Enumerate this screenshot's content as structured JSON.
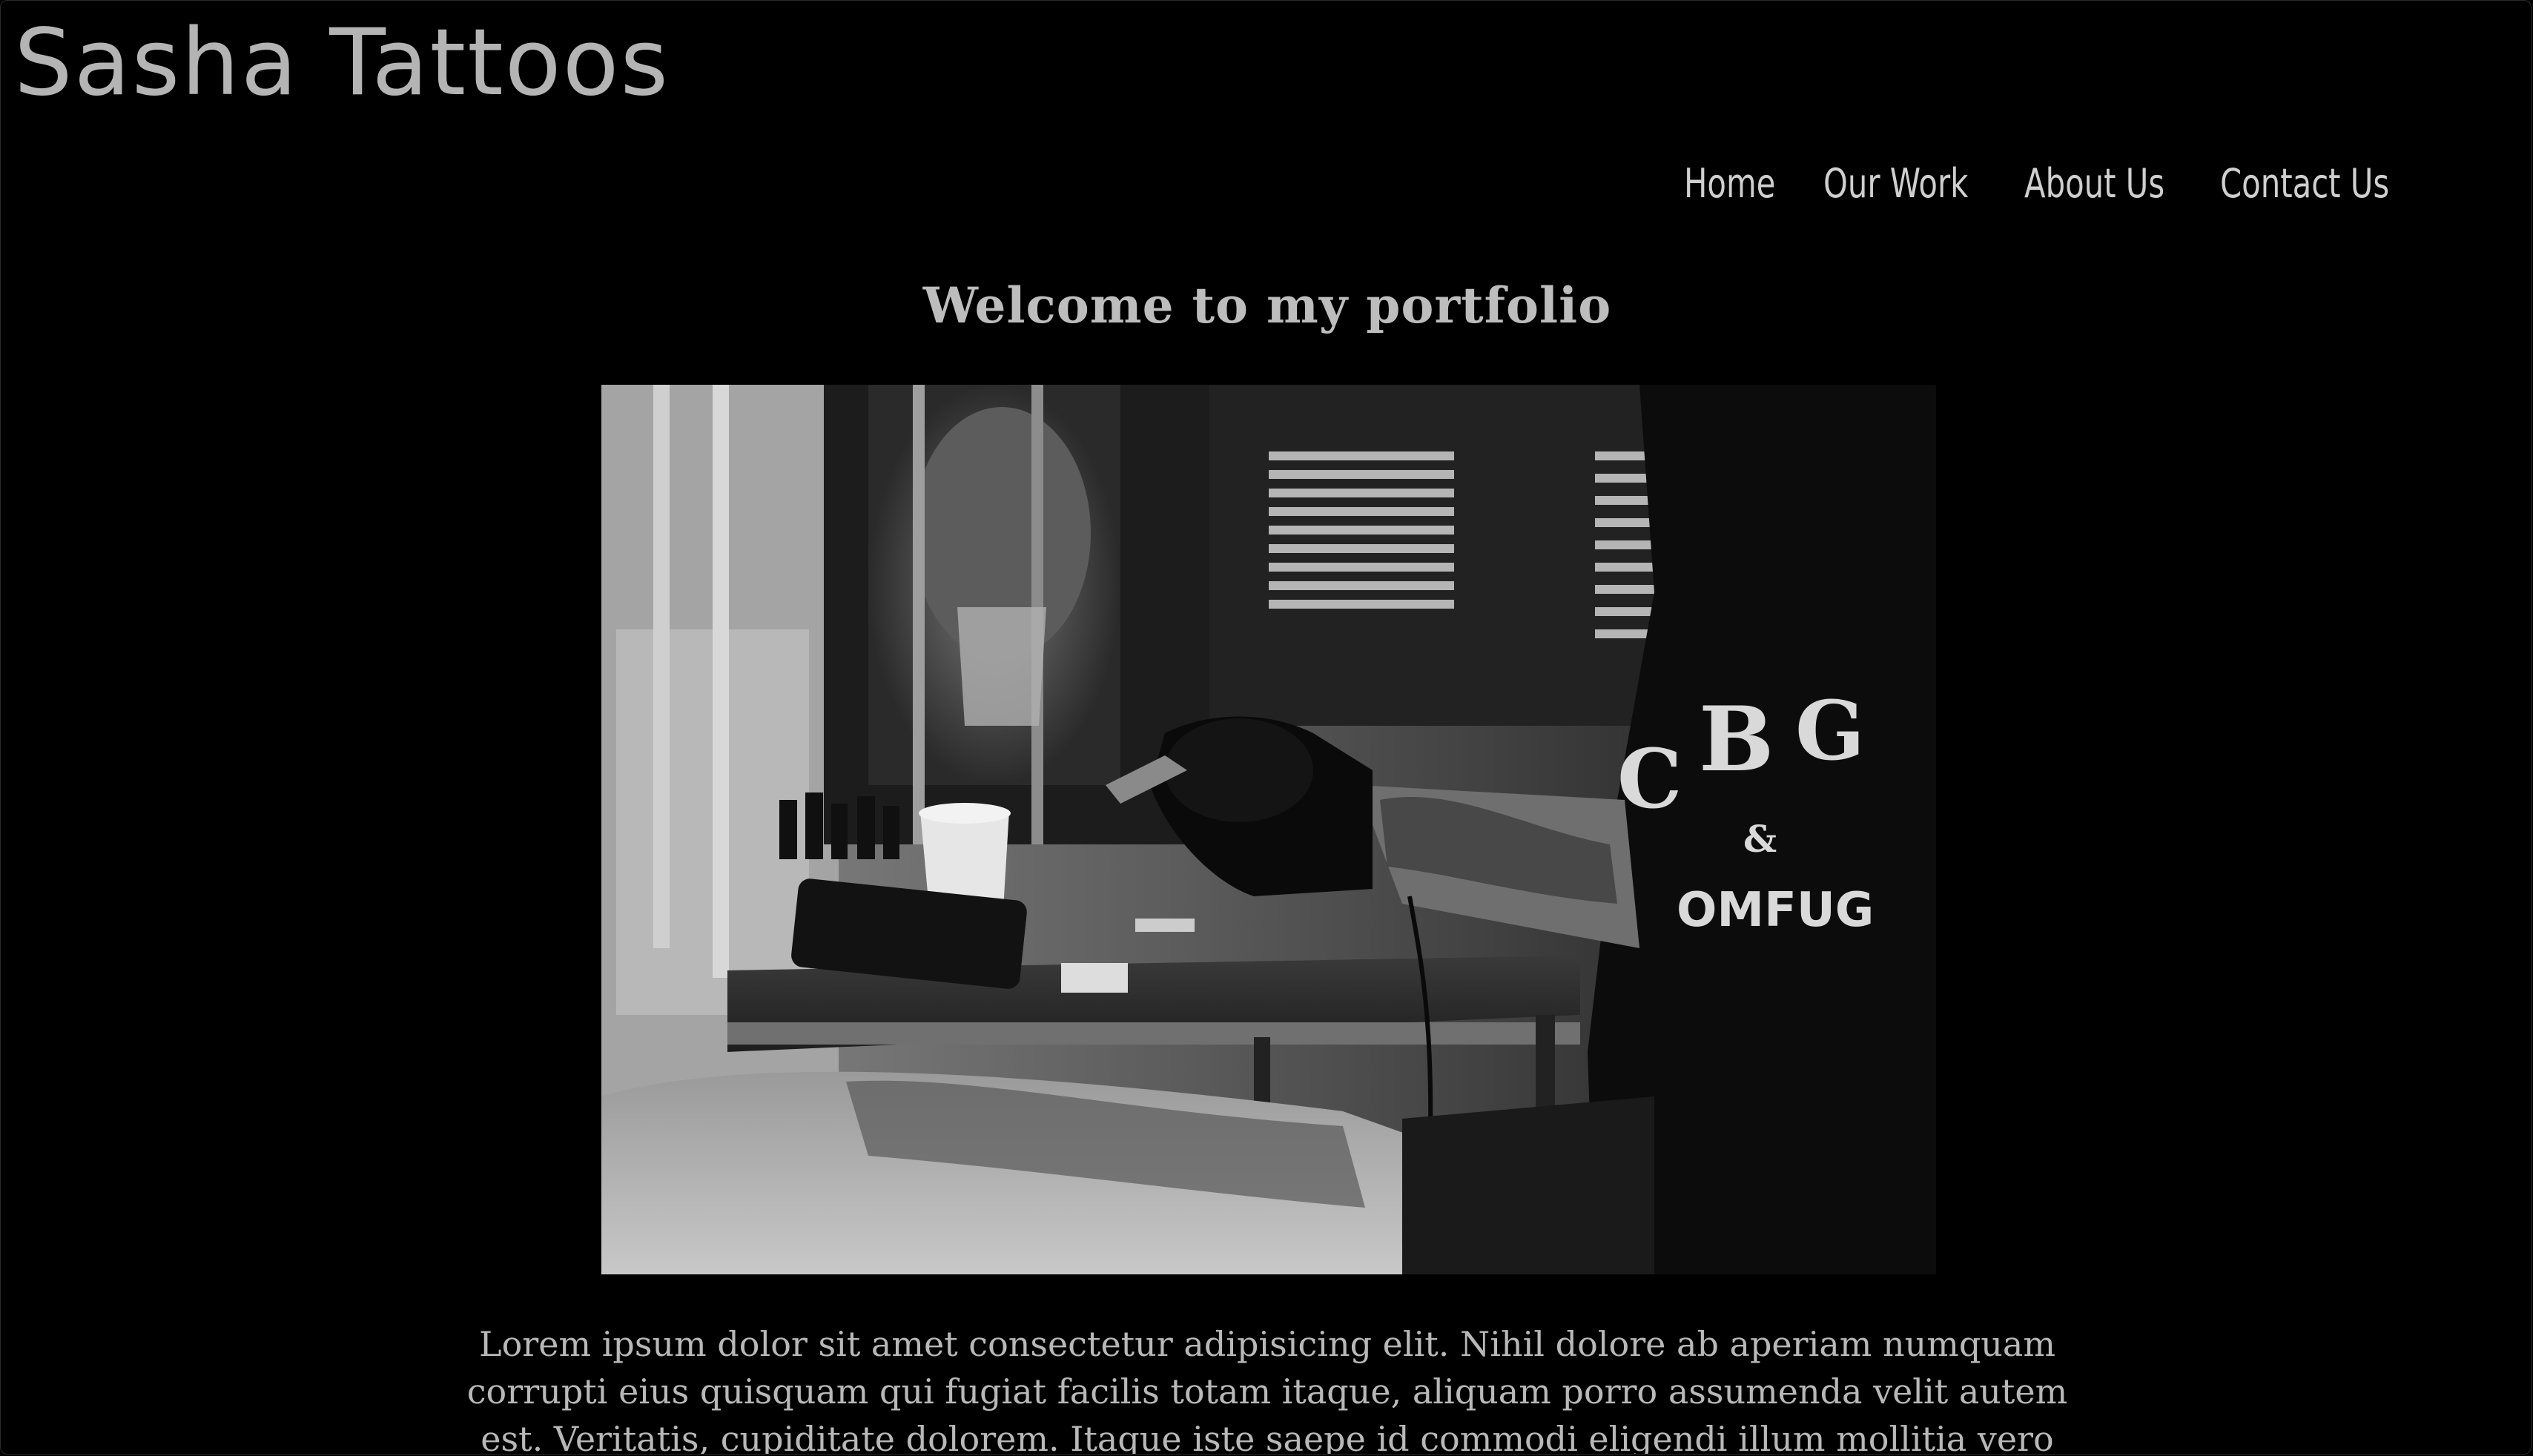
{
  "site": {
    "title": "Sasha Tattoos"
  },
  "nav": {
    "items": [
      {
        "label": "Home"
      },
      {
        "label": "Our Work"
      },
      {
        "label": "About Us"
      },
      {
        "label": "Contact Us"
      }
    ]
  },
  "main": {
    "heading": "Welcome to my portfolio",
    "hero_image_shirt_text": [
      "C",
      "B",
      "G",
      "&",
      "OMFUG"
    ],
    "intro_lines": [
      "Lorem ipsum dolor sit amet consectetur adipisicing elit. Nihil dolore ab aperiam numquam",
      "corrupti eius quisquam qui fugiat facilis totam itaque, aliquam porro assumenda velit autem",
      "est. Veritatis, cupiditate dolorem. Itaque iste saepe id commodi eligendi illum mollitia vero"
    ]
  },
  "colors": {
    "background": "#000000",
    "title": "#b4b4b4",
    "nav": "#cfcfcf",
    "heading": "#bdbdbd",
    "body_text": "#b8b8b8"
  }
}
